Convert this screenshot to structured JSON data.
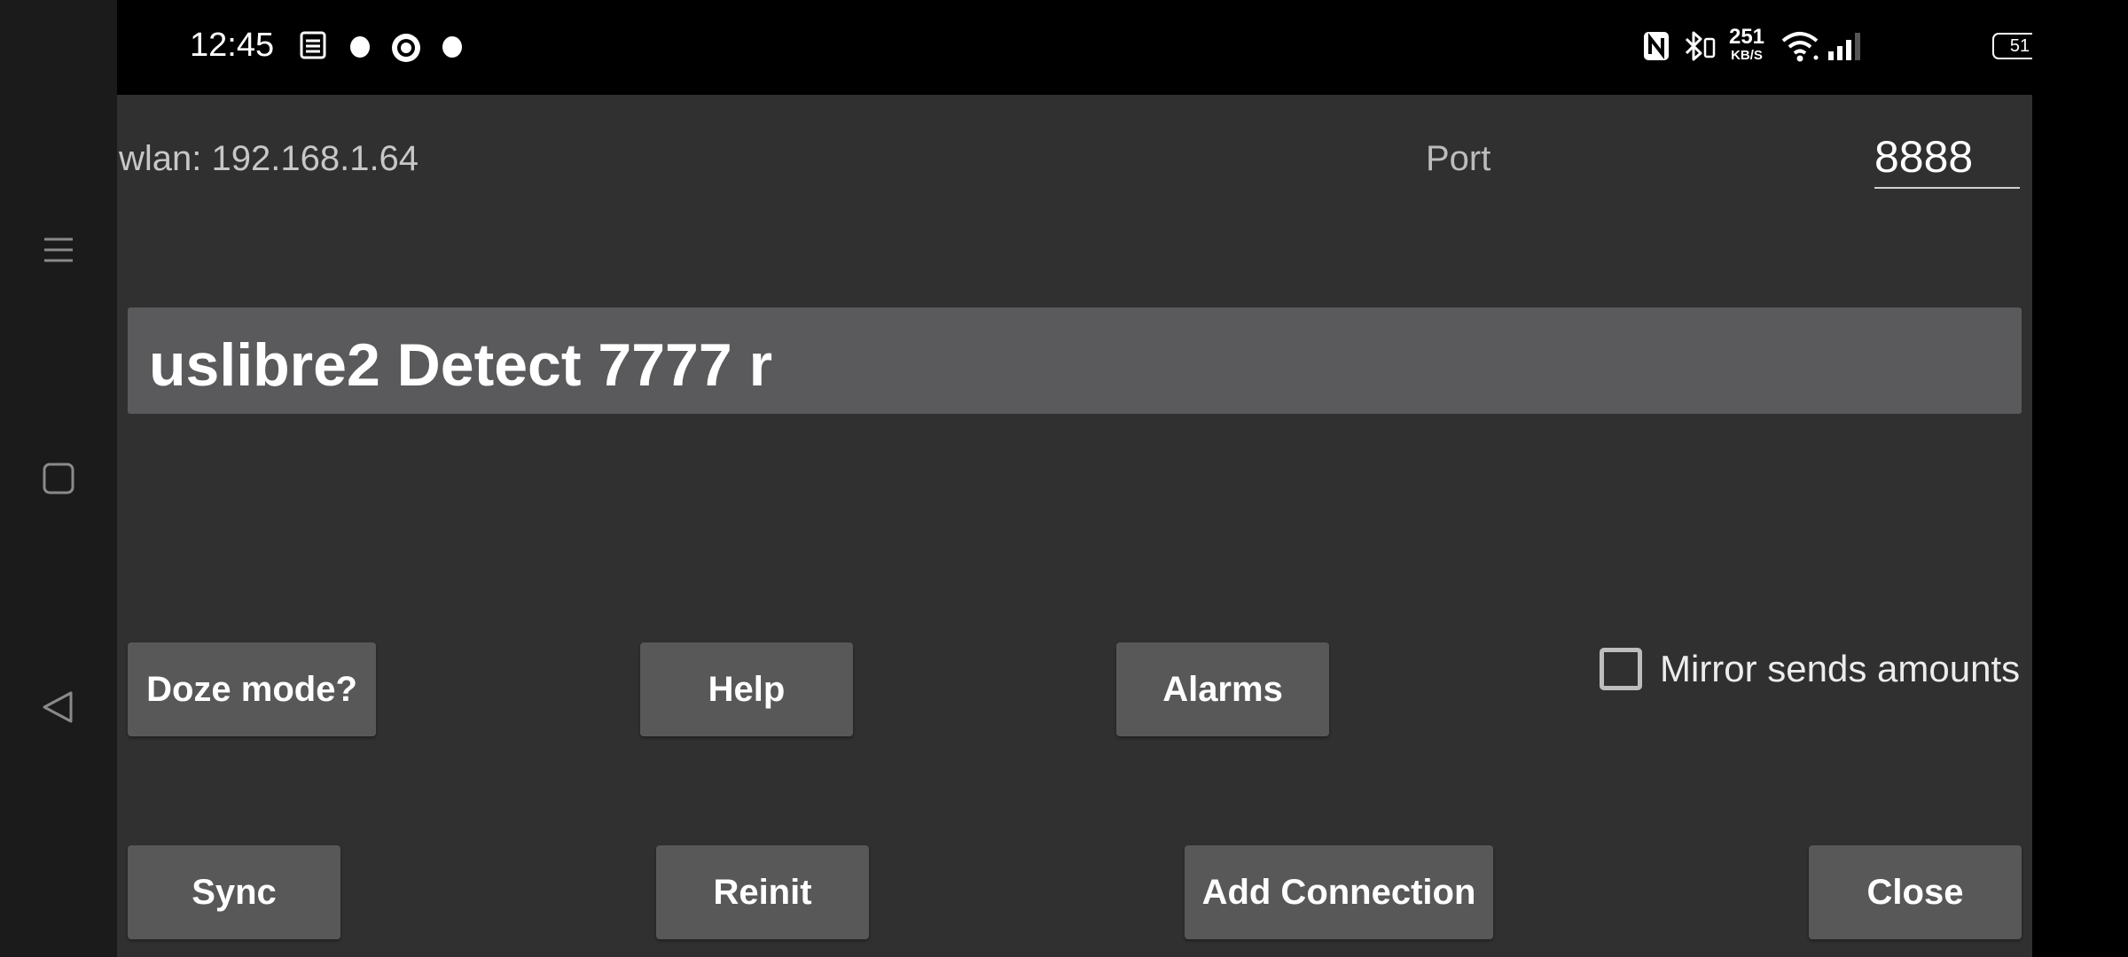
{
  "status_bar": {
    "time": "12:45",
    "net_speed_value": "251",
    "net_speed_unit": "KB/S",
    "battery": "51",
    "icons": [
      "notes-icon",
      "notification-dot-icon",
      "record-icon",
      "notification-dot-icon",
      "nfc-icon",
      "bluetooth-icon",
      "wifi-icon",
      "signal-icon",
      "battery-icon",
      "charging-icon"
    ]
  },
  "nav": {
    "icons": [
      "menu-icon",
      "home-square-icon",
      "back-triangle-icon"
    ]
  },
  "header": {
    "wlan_text": "wlan: 192.168.1.64",
    "port_label": "Port",
    "port_value": "8888"
  },
  "status_message": "uslibre2 Detect 7777 r",
  "buttons": {
    "doze": "Doze mode?",
    "help": "Help",
    "alarms": "Alarms",
    "sync": "Sync",
    "reinit": "Reinit",
    "add_connection": "Add Connection",
    "close": "Close"
  },
  "mirror_checkbox": {
    "label": "Mirror sends amounts",
    "checked": false
  },
  "colors": {
    "background": "#303030",
    "button": "#585858",
    "status_box": "#5a5a5c"
  }
}
